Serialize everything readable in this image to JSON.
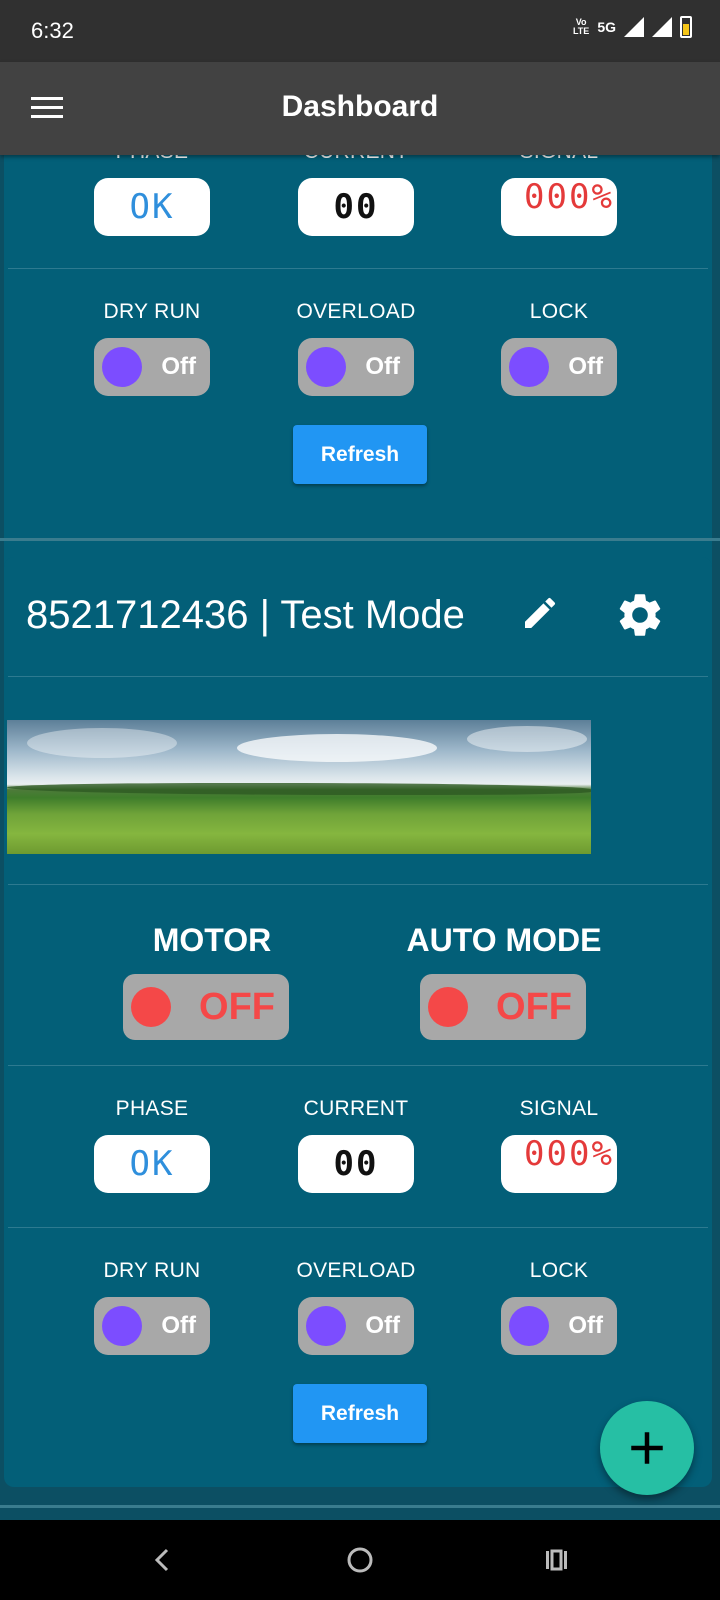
{
  "status_bar": {
    "time": "6:32",
    "volte": [
      "Vo",
      "LTE"
    ],
    "network": "5G"
  },
  "app_bar": {
    "title": "Dashboard",
    "menu_icon": "hamburger-menu-icon"
  },
  "devices": [
    {
      "readouts": {
        "phase": {
          "label": "PHASE",
          "value": "OK"
        },
        "current": {
          "label": "CURRENT",
          "value": "00"
        },
        "signal": {
          "label": "SIGNAL",
          "value": "000%"
        }
      },
      "switches": {
        "dry_run": {
          "label": "DRY RUN",
          "state": "Off"
        },
        "overload": {
          "label": "OVERLOAD",
          "state": "Off"
        },
        "lock": {
          "label": "LOCK",
          "state": "Off"
        }
      },
      "refresh_label": "Refresh"
    },
    {
      "title": "8521712436 | Test Mode",
      "icons": [
        "edit-icon",
        "gear-icon"
      ],
      "motor": {
        "label": "MOTOR",
        "state": "OFF"
      },
      "auto_mode": {
        "label": "AUTO MODE",
        "state": "OFF"
      },
      "readouts": {
        "phase": {
          "label": "PHASE",
          "value": "OK"
        },
        "current": {
          "label": "CURRENT",
          "value": "00"
        },
        "signal": {
          "label": "SIGNAL",
          "value": "000%"
        }
      },
      "switches": {
        "dry_run": {
          "label": "DRY RUN",
          "state": "Off"
        },
        "overload": {
          "label": "OVERLOAD",
          "state": "Off"
        },
        "lock": {
          "label": "LOCK",
          "state": "Off"
        }
      },
      "refresh_label": "Refresh"
    }
  ],
  "fab": {
    "icon": "plus-icon"
  },
  "nav_bar": {
    "icons": [
      "back-icon",
      "home-icon",
      "recents-icon"
    ]
  },
  "colors": {
    "background": "#0c4f63",
    "card": "#035f78",
    "app_bar": "#424242",
    "refresh_button": "#2196f3",
    "fab": "#26bfa4",
    "switch_knob_off": "#7c4dff",
    "motor_knob_off": "#f44848"
  }
}
